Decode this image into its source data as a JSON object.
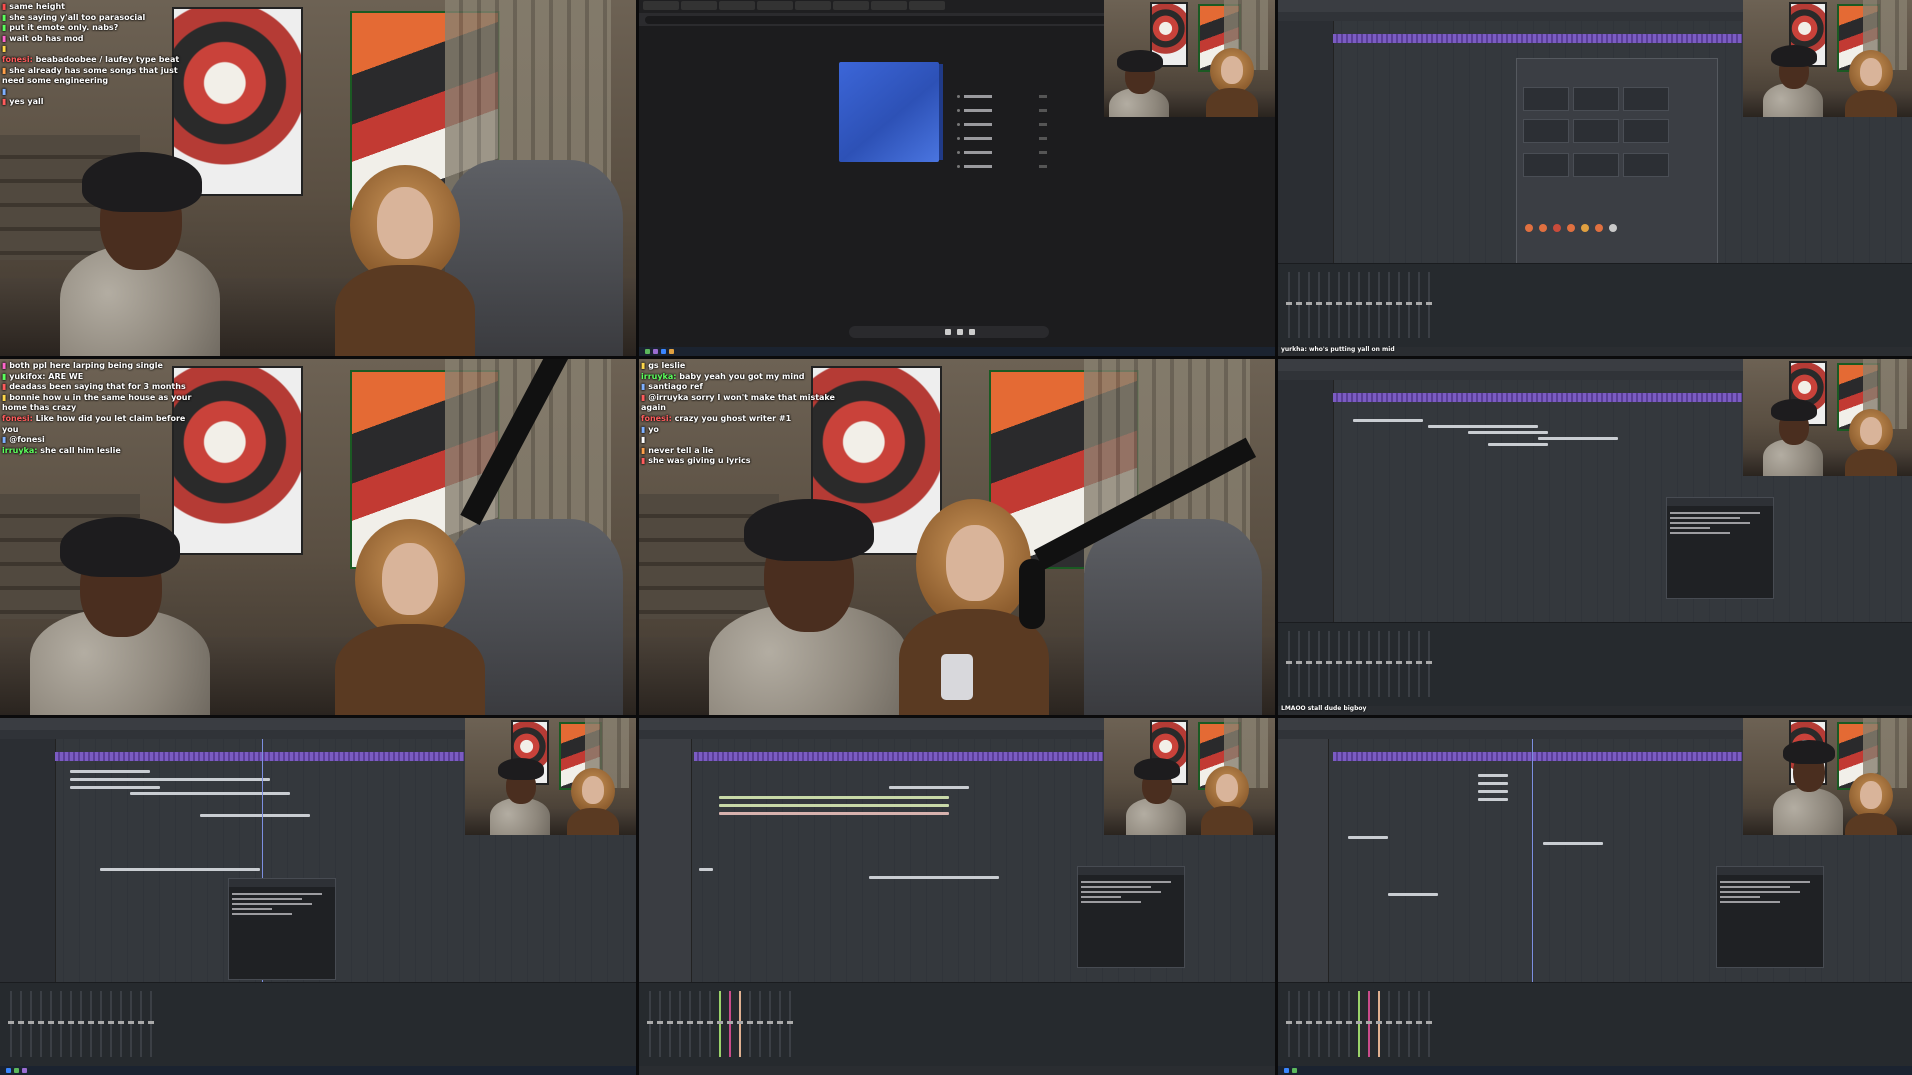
{
  "colors": {
    "accent_purple": "#7b5cc2",
    "album_blue": "#3c66d8",
    "daw_bg": "#2a2d31",
    "chat_text": "#ffffff"
  },
  "cell1": {
    "chat": [
      {
        "user": "",
        "color": "#ff4d4d",
        "msg": "same height"
      },
      {
        "user": "",
        "color": "#5cff5c",
        "msg": "she saying y'all too parasocial"
      },
      {
        "user": "",
        "color": "#5cff5c",
        "msg": "put it emote only. nabs?"
      },
      {
        "user": "",
        "color": "#ff66cc",
        "msg": "wait ob has mod"
      },
      {
        "user": "",
        "color": "#ffd84a",
        "msg": ""
      },
      {
        "user": "fonesi:",
        "color": "#ff5c5c",
        "msg": "beabadoobee / laufey type beat"
      },
      {
        "user": "",
        "color": "#ffa04a",
        "msg": "she already has some songs that just need some engineering"
      },
      {
        "user": "",
        "color": "#7fb0ff",
        "msg": ""
      },
      {
        "user": "",
        "color": "#ff5c5c",
        "msg": "yes yall"
      }
    ]
  },
  "cell4": {
    "chat": [
      {
        "user": "",
        "color": "#ff66cc",
        "msg": "both ppl here larping being single"
      },
      {
        "user": "",
        "color": "#5cff5c",
        "msg": "yukifox:  ARE WE"
      },
      {
        "user": "",
        "color": "#ff5c5c",
        "msg": "deadass been saying that for 3 months"
      },
      {
        "user": "",
        "color": "#ffd84a",
        "msg": "bonnie how u in the same house as your home  thas crazy"
      },
      {
        "user": "fonesi:",
        "color": "#ff5c5c",
        "msg": "Like how did you let  claim before you"
      },
      {
        "user": "",
        "color": "#7fb0ff",
        "msg": "@fonesi"
      },
      {
        "user": "irruyka:",
        "color": "#5cff5c",
        "msg": "she call him leslie"
      }
    ]
  },
  "cell5": {
    "chat": [
      {
        "user": "",
        "color": "#ffd84a",
        "msg": "gs leslie"
      },
      {
        "user": "irruyka:",
        "color": "#5cff5c",
        "msg": "baby yeah you got my mind"
      },
      {
        "user": "",
        "color": "#7fb0ff",
        "msg": "santiago ref"
      },
      {
        "user": "",
        "color": "#ff5c5c",
        "msg": "@irruyka sorry I won't make that mistake again"
      },
      {
        "user": "fonesi:",
        "color": "#ff5c5c",
        "msg": "crazy you ghost writer #1"
      },
      {
        "user": "",
        "color": "#7fb0ff",
        "msg": "yo"
      },
      {
        "user": "",
        "color": "#ffffff",
        "msg": ""
      },
      {
        "user": "",
        "color": "#ffa04a",
        "msg": "never tell a lie"
      },
      {
        "user": "",
        "color": "#ff5c5c",
        "msg": "she was giving u lyrics"
      }
    ]
  },
  "cell3": {
    "bottom_chat": "yurkha: who's putting yall on mid"
  },
  "cell6": {
    "bottom_chat": "LMAOO  stall dude bigboy"
  }
}
